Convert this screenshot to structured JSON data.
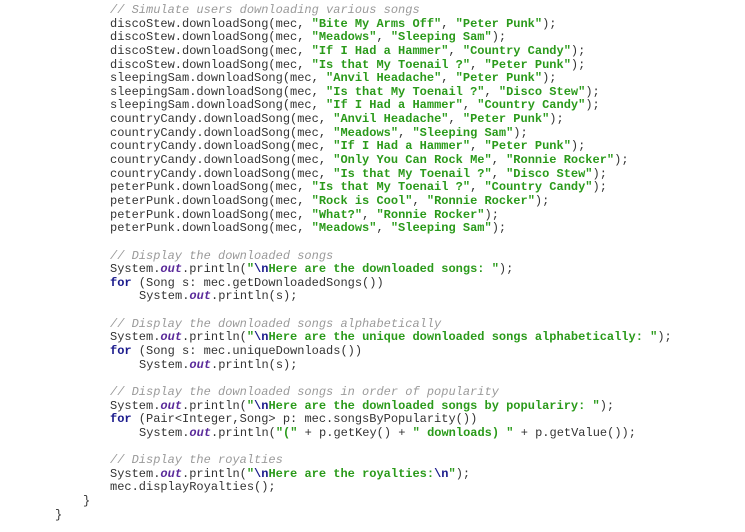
{
  "editor": {
    "language": "java",
    "colors": {
      "comment": "#9a9a9a",
      "string": "#2a9a1a",
      "keyword": "#1a1a8c",
      "field": "#5a2a9a",
      "plain": "#333333",
      "background": "#ffffff"
    },
    "lines": [
      {
        "indent": 3,
        "tokens": [
          {
            "t": "cmt",
            "v": "// Simulate users downloading various songs"
          }
        ]
      },
      {
        "indent": 3,
        "tokens": [
          {
            "t": "pln",
            "v": "discoStew.downloadSong(mec, "
          },
          {
            "t": "str",
            "v": "\"Bite My Arms Off\""
          },
          {
            "t": "pln",
            "v": ", "
          },
          {
            "t": "str",
            "v": "\"Peter Punk\""
          },
          {
            "t": "pln",
            "v": ");"
          }
        ]
      },
      {
        "indent": 3,
        "tokens": [
          {
            "t": "pln",
            "v": "discoStew.downloadSong(mec, "
          },
          {
            "t": "str",
            "v": "\"Meadows\""
          },
          {
            "t": "pln",
            "v": ", "
          },
          {
            "t": "str",
            "v": "\"Sleeping Sam\""
          },
          {
            "t": "pln",
            "v": ");"
          }
        ]
      },
      {
        "indent": 3,
        "tokens": [
          {
            "t": "pln",
            "v": "discoStew.downloadSong(mec, "
          },
          {
            "t": "str",
            "v": "\"If I Had a Hammer\""
          },
          {
            "t": "pln",
            "v": ", "
          },
          {
            "t": "str",
            "v": "\"Country Candy\""
          },
          {
            "t": "pln",
            "v": ");"
          }
        ]
      },
      {
        "indent": 3,
        "tokens": [
          {
            "t": "pln",
            "v": "discoStew.downloadSong(mec, "
          },
          {
            "t": "str",
            "v": "\"Is that My Toenail ?\""
          },
          {
            "t": "pln",
            "v": ", "
          },
          {
            "t": "str",
            "v": "\"Peter Punk\""
          },
          {
            "t": "pln",
            "v": ");"
          }
        ]
      },
      {
        "indent": 3,
        "tokens": [
          {
            "t": "pln",
            "v": "sleepingSam.downloadSong(mec, "
          },
          {
            "t": "str",
            "v": "\"Anvil Headache\""
          },
          {
            "t": "pln",
            "v": ", "
          },
          {
            "t": "str",
            "v": "\"Peter Punk\""
          },
          {
            "t": "pln",
            "v": ");"
          }
        ]
      },
      {
        "indent": 3,
        "tokens": [
          {
            "t": "pln",
            "v": "sleepingSam.downloadSong(mec, "
          },
          {
            "t": "str",
            "v": "\"Is that My Toenail ?\""
          },
          {
            "t": "pln",
            "v": ", "
          },
          {
            "t": "str",
            "v": "\"Disco Stew\""
          },
          {
            "t": "pln",
            "v": ");"
          }
        ]
      },
      {
        "indent": 3,
        "tokens": [
          {
            "t": "pln",
            "v": "sleepingSam.downloadSong(mec, "
          },
          {
            "t": "str",
            "v": "\"If I Had a Hammer\""
          },
          {
            "t": "pln",
            "v": ", "
          },
          {
            "t": "str",
            "v": "\"Country Candy\""
          },
          {
            "t": "pln",
            "v": ");"
          }
        ]
      },
      {
        "indent": 3,
        "tokens": [
          {
            "t": "pln",
            "v": "countryCandy.downloadSong(mec, "
          },
          {
            "t": "str",
            "v": "\"Anvil Headache\""
          },
          {
            "t": "pln",
            "v": ", "
          },
          {
            "t": "str",
            "v": "\"Peter Punk\""
          },
          {
            "t": "pln",
            "v": ");"
          }
        ]
      },
      {
        "indent": 3,
        "tokens": [
          {
            "t": "pln",
            "v": "countryCandy.downloadSong(mec, "
          },
          {
            "t": "str",
            "v": "\"Meadows\""
          },
          {
            "t": "pln",
            "v": ", "
          },
          {
            "t": "str",
            "v": "\"Sleeping Sam\""
          },
          {
            "t": "pln",
            "v": ");"
          }
        ]
      },
      {
        "indent": 3,
        "tokens": [
          {
            "t": "pln",
            "v": "countryCandy.downloadSong(mec, "
          },
          {
            "t": "str",
            "v": "\"If I Had a Hammer\""
          },
          {
            "t": "pln",
            "v": ", "
          },
          {
            "t": "str",
            "v": "\"Peter Punk\""
          },
          {
            "t": "pln",
            "v": ");"
          }
        ]
      },
      {
        "indent": 3,
        "tokens": [
          {
            "t": "pln",
            "v": "countryCandy.downloadSong(mec, "
          },
          {
            "t": "str",
            "v": "\"Only You Can Rock Me\""
          },
          {
            "t": "pln",
            "v": ", "
          },
          {
            "t": "str",
            "v": "\"Ronnie Rocker\""
          },
          {
            "t": "pln",
            "v": ");"
          }
        ]
      },
      {
        "indent": 3,
        "tokens": [
          {
            "t": "pln",
            "v": "countryCandy.downloadSong(mec, "
          },
          {
            "t": "str",
            "v": "\"Is that My Toenail ?\""
          },
          {
            "t": "pln",
            "v": ", "
          },
          {
            "t": "str",
            "v": "\"Disco Stew\""
          },
          {
            "t": "pln",
            "v": ");"
          }
        ]
      },
      {
        "indent": 3,
        "tokens": [
          {
            "t": "pln",
            "v": "peterPunk.downloadSong(mec, "
          },
          {
            "t": "str",
            "v": "\"Is that My Toenail ?\""
          },
          {
            "t": "pln",
            "v": ", "
          },
          {
            "t": "str",
            "v": "\"Country Candy\""
          },
          {
            "t": "pln",
            "v": ");"
          }
        ]
      },
      {
        "indent": 3,
        "tokens": [
          {
            "t": "pln",
            "v": "peterPunk.downloadSong(mec, "
          },
          {
            "t": "str",
            "v": "\"Rock is Cool\""
          },
          {
            "t": "pln",
            "v": ", "
          },
          {
            "t": "str",
            "v": "\"Ronnie Rocker\""
          },
          {
            "t": "pln",
            "v": ");"
          }
        ]
      },
      {
        "indent": 3,
        "tokens": [
          {
            "t": "pln",
            "v": "peterPunk.downloadSong(mec, "
          },
          {
            "t": "str",
            "v": "\"What?\""
          },
          {
            "t": "pln",
            "v": ", "
          },
          {
            "t": "str",
            "v": "\"Ronnie Rocker\""
          },
          {
            "t": "pln",
            "v": ");"
          }
        ]
      },
      {
        "indent": 3,
        "tokens": [
          {
            "t": "pln",
            "v": "peterPunk.downloadSong(mec, "
          },
          {
            "t": "str",
            "v": "\"Meadows\""
          },
          {
            "t": "pln",
            "v": ", "
          },
          {
            "t": "str",
            "v": "\"Sleeping Sam\""
          },
          {
            "t": "pln",
            "v": ");"
          }
        ]
      },
      {
        "indent": 0,
        "tokens": []
      },
      {
        "indent": 3,
        "tokens": [
          {
            "t": "cmt",
            "v": "// Display the downloaded songs"
          }
        ]
      },
      {
        "indent": 3,
        "tokens": [
          {
            "t": "pln",
            "v": "System."
          },
          {
            "t": "fld",
            "v": "out"
          },
          {
            "t": "pln",
            "v": ".println("
          },
          {
            "t": "str",
            "v": "\""
          },
          {
            "t": "esc",
            "v": "\\n"
          },
          {
            "t": "str",
            "v": "Here are the downloaded songs: \""
          },
          {
            "t": "pln",
            "v": ");"
          }
        ]
      },
      {
        "indent": 3,
        "tokens": [
          {
            "t": "kw",
            "v": "for"
          },
          {
            "t": "pln",
            "v": " (Song s: mec.getDownloadedSongs())"
          }
        ]
      },
      {
        "indent": 4,
        "tokens": [
          {
            "t": "pln",
            "v": "System."
          },
          {
            "t": "fld",
            "v": "out"
          },
          {
            "t": "pln",
            "v": ".println(s);"
          }
        ]
      },
      {
        "indent": 0,
        "tokens": []
      },
      {
        "indent": 3,
        "tokens": [
          {
            "t": "cmt",
            "v": "// Display the downloaded songs alphabetically"
          }
        ]
      },
      {
        "indent": 3,
        "tokens": [
          {
            "t": "pln",
            "v": "System."
          },
          {
            "t": "fld",
            "v": "out"
          },
          {
            "t": "pln",
            "v": ".println("
          },
          {
            "t": "str",
            "v": "\""
          },
          {
            "t": "esc",
            "v": "\\n"
          },
          {
            "t": "str",
            "v": "Here are the unique downloaded songs alphabetically: \""
          },
          {
            "t": "pln",
            "v": ");"
          }
        ]
      },
      {
        "indent": 3,
        "tokens": [
          {
            "t": "kw",
            "v": "for"
          },
          {
            "t": "pln",
            "v": " (Song s: mec.uniqueDownloads())"
          }
        ]
      },
      {
        "indent": 4,
        "tokens": [
          {
            "t": "pln",
            "v": "System."
          },
          {
            "t": "fld",
            "v": "out"
          },
          {
            "t": "pln",
            "v": ".println(s);"
          }
        ]
      },
      {
        "indent": 0,
        "tokens": []
      },
      {
        "indent": 3,
        "tokens": [
          {
            "t": "cmt",
            "v": "// Display the downloaded songs in order of popularity"
          }
        ]
      },
      {
        "indent": 3,
        "tokens": [
          {
            "t": "pln",
            "v": "System."
          },
          {
            "t": "fld",
            "v": "out"
          },
          {
            "t": "pln",
            "v": ".println("
          },
          {
            "t": "str",
            "v": "\""
          },
          {
            "t": "esc",
            "v": "\\n"
          },
          {
            "t": "str",
            "v": "Here are the downloaded songs by populariry: \""
          },
          {
            "t": "pln",
            "v": ");"
          }
        ]
      },
      {
        "indent": 3,
        "tokens": [
          {
            "t": "kw",
            "v": "for"
          },
          {
            "t": "pln",
            "v": " (Pair<Integer,Song> p: mec.songsByPopularity())"
          }
        ]
      },
      {
        "indent": 4,
        "tokens": [
          {
            "t": "pln",
            "v": "System."
          },
          {
            "t": "fld",
            "v": "out"
          },
          {
            "t": "pln",
            "v": ".println("
          },
          {
            "t": "str",
            "v": "\"(\""
          },
          {
            "t": "pln",
            "v": " + p.getKey() + "
          },
          {
            "t": "str",
            "v": "\" downloads) \""
          },
          {
            "t": "pln",
            "v": " + p.getValue());"
          }
        ]
      },
      {
        "indent": 0,
        "tokens": []
      },
      {
        "indent": 3,
        "tokens": [
          {
            "t": "cmt",
            "v": "// Display the royalties"
          }
        ]
      },
      {
        "indent": 3,
        "tokens": [
          {
            "t": "pln",
            "v": "System."
          },
          {
            "t": "fld",
            "v": "out"
          },
          {
            "t": "pln",
            "v": ".println("
          },
          {
            "t": "str",
            "v": "\""
          },
          {
            "t": "esc",
            "v": "\\n"
          },
          {
            "t": "str",
            "v": "Here are the royalties:"
          },
          {
            "t": "esc",
            "v": "\\n"
          },
          {
            "t": "str",
            "v": "\""
          },
          {
            "t": "pln",
            "v": ");"
          }
        ]
      },
      {
        "indent": 3,
        "tokens": [
          {
            "t": "pln",
            "v": "mec.displayRoyalties();"
          }
        ]
      },
      {
        "indent": 2,
        "tokens": [
          {
            "t": "pln",
            "v": "}"
          }
        ]
      },
      {
        "indent": 1,
        "tokens": [
          {
            "t": "pln",
            "v": "}"
          }
        ]
      }
    ]
  }
}
